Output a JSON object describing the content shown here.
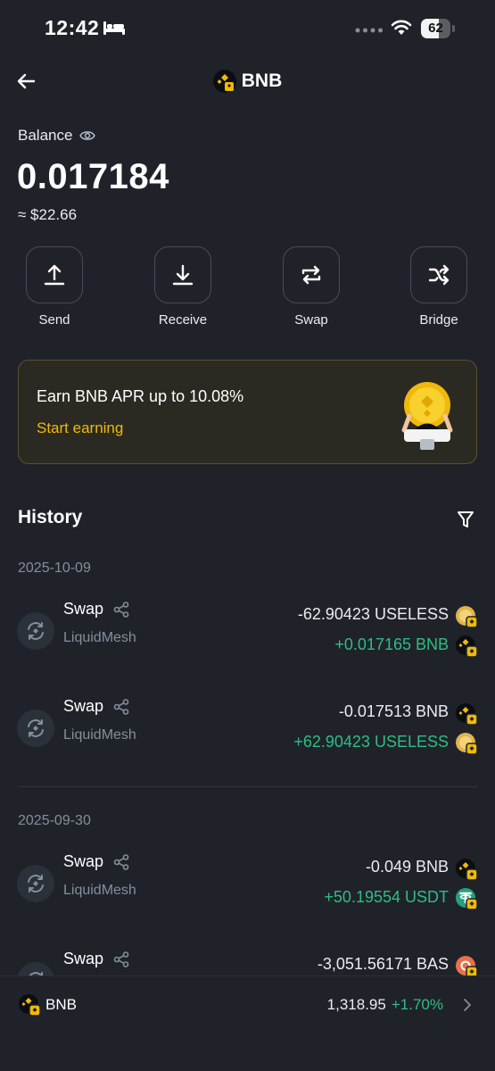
{
  "status_bar": {
    "time": "12:42",
    "battery": "62",
    "battery_fraction": 0.62
  },
  "header": {
    "title": "BNB"
  },
  "balance": {
    "label": "Balance",
    "value": "0.017184",
    "fiat": "≈ $22.66"
  },
  "actions": [
    {
      "label": "Send",
      "icon": "upload-icon"
    },
    {
      "label": "Receive",
      "icon": "download-icon"
    },
    {
      "label": "Swap",
      "icon": "swap-icon"
    },
    {
      "label": "Bridge",
      "icon": "shuffle-icon"
    }
  ],
  "earn": {
    "title": "Earn BNB APR up to 10.08%",
    "link": "Start earning"
  },
  "history": {
    "title": "History",
    "groups": [
      {
        "date": "2025-10-09",
        "items": [
          {
            "type": "Swap",
            "source": "LiquidMesh",
            "out": "-62.90423 USELESS",
            "out_coin": "useless",
            "in": "+0.017165 BNB",
            "in_coin": "bnb"
          },
          {
            "type": "Swap",
            "source": "LiquidMesh",
            "out": "-0.017513 BNB",
            "out_coin": "bnb",
            "in": "+62.90423 USELESS",
            "in_coin": "useless"
          }
        ]
      },
      {
        "date": "2025-09-30",
        "items": [
          {
            "type": "Swap",
            "source": "LiquidMesh",
            "out": "-0.049 BNB",
            "out_coin": "bnb",
            "in": "+50.19554 USDT",
            "in_coin": "usdt"
          },
          {
            "type": "Swap",
            "source": "",
            "out": "-3,051.56171 BAS",
            "out_coin": "bas",
            "in": "",
            "in_coin": ""
          }
        ]
      }
    ]
  },
  "bottom_bar": {
    "symbol": "BNB",
    "price": "1,318.95",
    "change": "+1.70%"
  },
  "colors": {
    "background": "#1f2329",
    "accent": "#f0b90b",
    "positive": "#2ebd85",
    "muted": "#848e9c"
  }
}
